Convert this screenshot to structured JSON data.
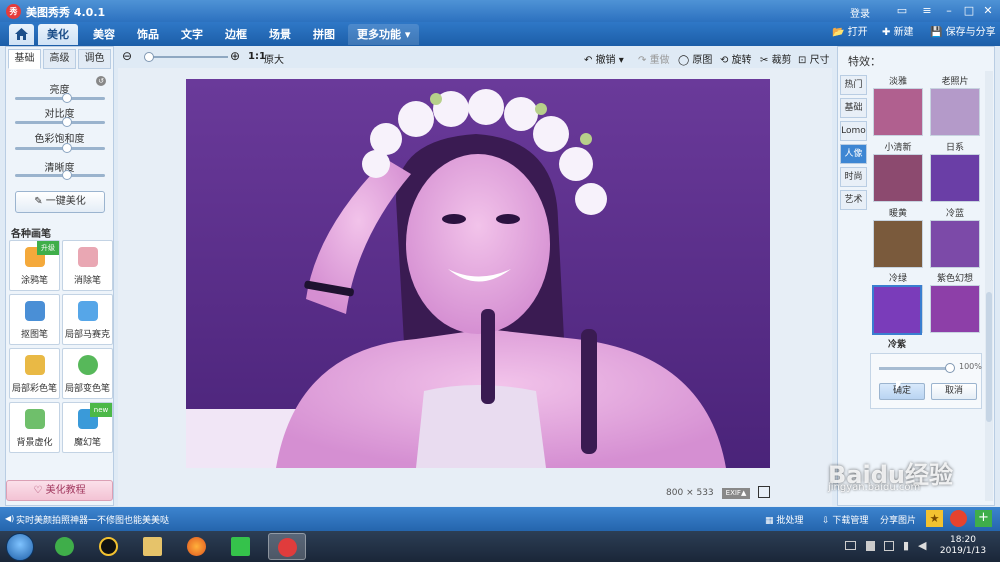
{
  "window": {
    "logo": "秀",
    "title": "美图秀秀 4.0.1",
    "login": "登录"
  },
  "tabs": [
    {
      "label": "美化",
      "active": true
    },
    {
      "label": "美容"
    },
    {
      "label": "饰品"
    },
    {
      "label": "文字"
    },
    {
      "label": "边框"
    },
    {
      "label": "场景"
    },
    {
      "label": "拼图"
    },
    {
      "label": "更多功能 ▾"
    }
  ],
  "top_actions": {
    "open": "打开",
    "new": "新建",
    "save": "保存与分享"
  },
  "left_panel": {
    "tabs": [
      "基础",
      "高级",
      "调色"
    ],
    "sliders": [
      {
        "label": "亮度",
        "level": 0.5
      },
      {
        "label": "对比度",
        "level": 0.5
      },
      {
        "label": "色彩饱和度",
        "level": 0.5
      },
      {
        "label": "清晰度",
        "level": 0.5
      }
    ],
    "auto_button": "一键美化",
    "brush_title": "各种画笔",
    "brushes": [
      {
        "label": "涂鸦笔",
        "badge": "升级",
        "color": "#f4a93b"
      },
      {
        "label": "消除笔",
        "color": "#e9a7b3"
      },
      {
        "label": "抠图笔",
        "color": "#4a8fd6"
      },
      {
        "label": "局部马赛克",
        "color": "#56a6e8"
      },
      {
        "label": "局部彩色笔",
        "color": "#e9b945"
      },
      {
        "label": "局部变色笔",
        "color": "#57b85a"
      },
      {
        "label": "背景虚化",
        "color": "#6fbf6b"
      },
      {
        "label": "魔幻笔",
        "badge": "new",
        "color": "#3a9ad9"
      }
    ],
    "tutorial": "美化教程"
  },
  "toolbar": {
    "zoom_ratio": "1:1",
    "original_size": "原大",
    "undo": "撤销",
    "redo": "重做",
    "original": "原图",
    "rotate": "旋转",
    "crop": "裁剪",
    "resize": "尺寸"
  },
  "canvas": {
    "width_px": "800",
    "times": "×",
    "height_px": "533",
    "exif": "EXIF▲"
  },
  "right_panel": {
    "title": "特效：",
    "categories": [
      {
        "label": "热门"
      },
      {
        "label": "基础"
      },
      {
        "label": "Lomo"
      },
      {
        "label": "人像",
        "active": true
      },
      {
        "label": "时尚"
      },
      {
        "label": "艺术"
      }
    ],
    "effects": [
      {
        "label": "淡雅",
        "tint": "#b0608f"
      },
      {
        "label": "老照片",
        "tint": "#b49ac9"
      },
      {
        "label": "小清新",
        "tint": "#8c4a6f"
      },
      {
        "label": "日系",
        "tint": "#6a3ea6"
      },
      {
        "label": "暖黄",
        "tint": "#7a5a3c"
      },
      {
        "label": "冷蓝",
        "tint": "#7c4aa8"
      },
      {
        "label": "冷绿",
        "tint": "#2c6b5a"
      },
      {
        "label": "紫色幻想",
        "tint": "#8d3fa8"
      },
      {
        "label": "冷紫",
        "tint": "#7a3cba",
        "selected": true
      }
    ],
    "intensity": "100%",
    "intensity_level": 1.0,
    "confirm": "确定",
    "cancel": "取消"
  },
  "status_bar": {
    "message": "实时美颜拍照神器一不修图也能美美哒",
    "batch": "批处理",
    "downloads": "下载管理",
    "share": "分享图片"
  },
  "watermark": {
    "text": "Baidu经验",
    "url": "jingyan.baidu.com"
  },
  "clock": {
    "time": "18:20",
    "date": "2019/1/13"
  },
  "taskbar_icons": [
    "ie-icon",
    "qq-icon",
    "explorer-icon",
    "firefox-icon",
    "video-icon",
    "meitu-icon"
  ]
}
